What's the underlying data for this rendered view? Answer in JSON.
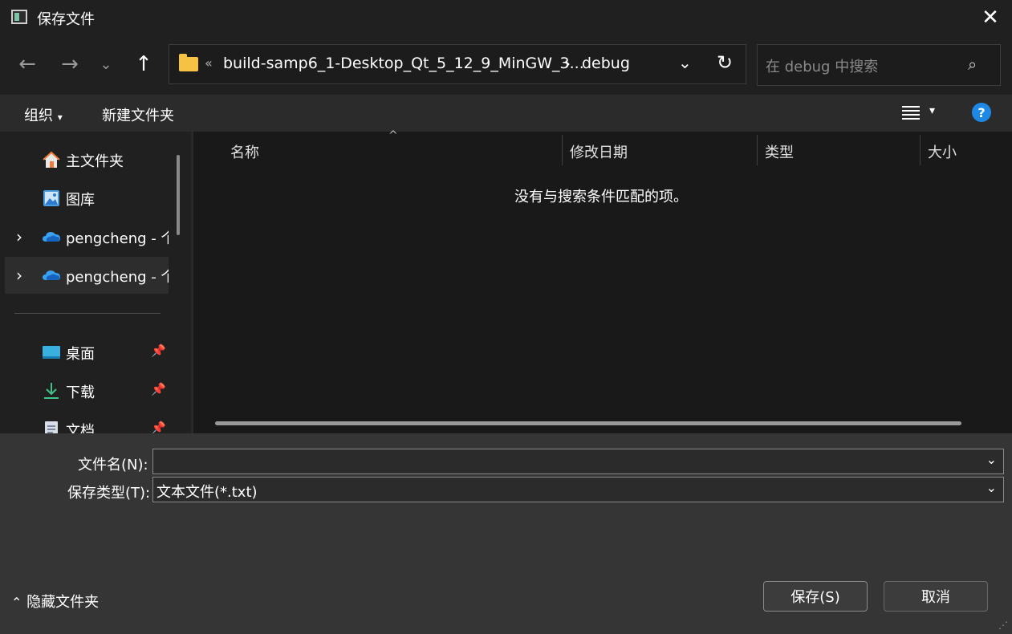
{
  "window": {
    "title": "保存文件"
  },
  "address": {
    "overflow": "«",
    "crumbs": [
      "build-samp6_1-Desktop_Qt_5_12_9_MinGW_3...",
      "debug"
    ],
    "separator": "›"
  },
  "search": {
    "placeholder": "在 debug 中搜索"
  },
  "commandbar": {
    "organize": "组织",
    "new_folder": "新建文件夹",
    "help": "?"
  },
  "sidebar": {
    "items": [
      {
        "label": "主文件夹",
        "icon": "home-icon",
        "pinned": false
      },
      {
        "label": "图库",
        "icon": "gallery-icon",
        "pinned": false
      },
      {
        "label": "pengcheng - 个",
        "icon": "onedrive-cloud-icon",
        "expandable": true
      },
      {
        "label": "pengcheng - 个",
        "icon": "onedrive-cloud-icon",
        "expandable": true,
        "selected": true
      },
      {
        "label": "桌面",
        "icon": "desktop-icon",
        "pinned": true
      },
      {
        "label": "下载",
        "icon": "download-icon",
        "pinned": true
      },
      {
        "label": "文档",
        "icon": "document-icon",
        "pinned": true
      }
    ]
  },
  "filelist": {
    "columns": [
      "名称",
      "修改日期",
      "类型",
      "大小"
    ],
    "empty_message": "没有与搜索条件匹配的项。"
  },
  "form": {
    "filename_label": "文件名(N):",
    "filename_value": "",
    "filetype_label": "保存类型(T):",
    "filetype_value": "文本文件(*.txt)"
  },
  "footer": {
    "hide_folders": "隐藏文件夹",
    "save": "保存(S)",
    "cancel": "取消"
  },
  "colors": {
    "accent": "#1e88e5",
    "folder": "#f5c243",
    "background": "#202020"
  }
}
